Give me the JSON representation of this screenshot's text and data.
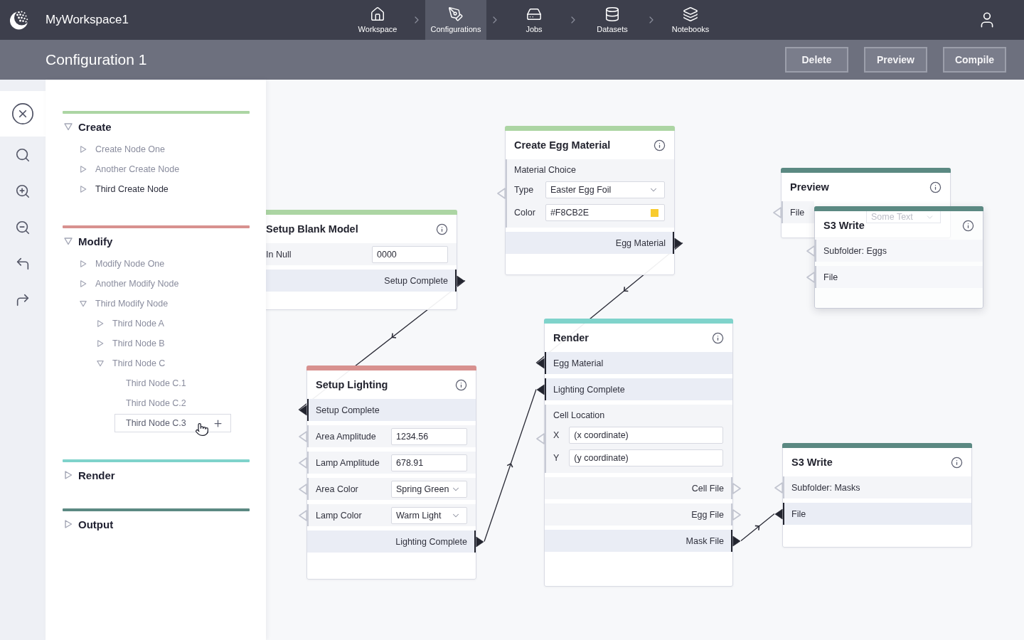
{
  "top_bar": {
    "workspace": "MyWorkspace1"
  },
  "nav": [
    {
      "kind": "home",
      "label": "Workspace",
      "selected": false
    },
    {
      "kind": "pen",
      "label": "Configurations",
      "selected": true
    },
    {
      "kind": "drive",
      "label": "Jobs",
      "selected": false
    },
    {
      "kind": "database",
      "label": "Datasets",
      "selected": false
    },
    {
      "kind": "layers",
      "label": "Notebooks",
      "selected": false
    }
  ],
  "header": {
    "title": "Configuration 1",
    "buttons": [
      "Delete",
      "Preview",
      "Compile"
    ]
  },
  "tools": [
    {
      "kind": "close",
      "selected": true
    },
    {
      "kind": "search",
      "selected": false
    },
    {
      "kind": "zoomin",
      "selected": false
    },
    {
      "kind": "zoomout",
      "selected": false
    },
    {
      "kind": "undo",
      "selected": false
    },
    {
      "kind": "redo",
      "selected": false
    }
  ],
  "palette": [
    {
      "title": "Create",
      "color": "#acd5a3",
      "expanded": true,
      "items": [
        {
          "kind": "branch",
          "label": "Create Node One",
          "expanded": false,
          "highlighted": false,
          "hovered": false
        },
        {
          "kind": "branch",
          "label": "Another Create Node",
          "expanded": false,
          "highlighted": false,
          "hovered": false
        },
        {
          "kind": "branch",
          "label": "Third Create Node",
          "expanded": false,
          "highlighted": true,
          "hovered": false
        }
      ]
    },
    {
      "title": "Modify",
      "color": "#d8918f",
      "expanded": true,
      "items": [
        {
          "kind": "branch",
          "label": "Modify Node One",
          "expanded": false,
          "highlighted": false,
          "hovered": false
        },
        {
          "kind": "branch",
          "label": "Another Modify Node",
          "expanded": false,
          "highlighted": false,
          "hovered": false
        },
        {
          "kind": "branch",
          "label": "Third Modify Node",
          "expanded": true,
          "highlighted": false,
          "hovered": false,
          "children": [
            {
              "kind": "branch",
              "label": "Third Node A",
              "expanded": false,
              "highlighted": false,
              "hovered": false
            },
            {
              "kind": "branch",
              "label": "Third Node B",
              "expanded": false,
              "highlighted": false,
              "hovered": false
            },
            {
              "kind": "branch",
              "label": "Third Node C",
              "expanded": true,
              "highlighted": false,
              "hovered": false,
              "children": [
                {
                  "kind": "leaf",
                  "label": "Third Node C.1",
                  "highlighted": false,
                  "hovered": false
                },
                {
                  "kind": "leaf",
                  "label": "Third Node C.2",
                  "highlighted": false,
                  "hovered": false
                },
                {
                  "kind": "leaf",
                  "label": "Third Node C.3",
                  "highlighted": false,
                  "hovered": true
                }
              ]
            }
          ]
        }
      ]
    },
    {
      "title": "Render",
      "color": "#7fd3cb",
      "expanded": false
    },
    {
      "title": "Output",
      "color": "#5b8982",
      "expanded": false
    }
  ],
  "nodes": [
    {
      "title": "Setup Blank Model",
      "color": "#acd5a3",
      "dragging": false,
      "rows": [
        {
          "kind": "field",
          "label": "In Null",
          "value": "0000"
        },
        {
          "kind": "out",
          "label": "Setup Complete",
          "connected": true
        }
      ]
    },
    {
      "title": "Create Egg Material",
      "color": "#acd5a3",
      "dragging": false,
      "rows": [
        {
          "kind": "group",
          "label": "Material Choice",
          "connected": false,
          "fields": [
            {
              "kind": "select",
              "label": "Type",
              "value": "Easter Egg Foil"
            },
            {
              "kind": "color",
              "label": "Color",
              "value": "#F8CB2E",
              "color": "#f8cb2e"
            }
          ]
        },
        {
          "kind": "out",
          "label": "Egg Material",
          "connected": true
        }
      ]
    },
    {
      "title": "Preview",
      "color": "#5b8982",
      "dragging": false,
      "rows": [
        {
          "kind": "in",
          "label": "File",
          "connected": false,
          "control": {
            "kind": "select",
            "placeholder": "Some Text"
          }
        }
      ]
    },
    {
      "title": "S3 Write",
      "color": "#5b8982",
      "dragging": true,
      "rows": [
        {
          "kind": "in",
          "label": "Subfolder: Eggs",
          "connected": false
        },
        {
          "kind": "in",
          "label": "File",
          "connected": false
        }
      ]
    },
    {
      "title": "Setup Lighting",
      "color": "#d8918f",
      "dragging": false,
      "rows": [
        {
          "kind": "in",
          "label": "Setup Complete",
          "connected": true
        },
        {
          "kind": "field",
          "label": "Area Amplitude",
          "value": "1234.56",
          "connected": false
        },
        {
          "kind": "field",
          "label": "Lamp Amplitude",
          "value": "678.91",
          "connected": false
        },
        {
          "kind": "select",
          "label": "Area Color",
          "value": "Spring Green",
          "connected": false
        },
        {
          "kind": "select",
          "label": "Lamp Color",
          "value": "Warm Light",
          "connected": false
        },
        {
          "kind": "out",
          "label": "Lighting Complete",
          "connected": true
        }
      ]
    },
    {
      "title": "Render",
      "color": "#7fd3cb",
      "dragging": false,
      "rows": [
        {
          "kind": "in",
          "label": "Egg Material",
          "connected": true
        },
        {
          "kind": "in",
          "label": "Lighting Complete",
          "connected": true
        },
        {
          "kind": "group",
          "label": "Cell Location",
          "connected": false,
          "fields": [
            {
              "kind": "field",
              "label": "X",
              "value": "(x coordinate)"
            },
            {
              "kind": "field",
              "label": "Y",
              "value": "(y coordinate)"
            }
          ]
        },
        {
          "kind": "out",
          "label": "Cell File",
          "connected": false
        },
        {
          "kind": "out",
          "label": "Egg File",
          "connected": false
        },
        {
          "kind": "out",
          "label": "Mask File",
          "connected": true
        }
      ]
    },
    {
      "title": "S3 Write",
      "color": "#5b8982",
      "dragging": false,
      "rows": [
        {
          "kind": "in",
          "label": "Subfolder: Masks",
          "connected": false
        },
        {
          "kind": "in",
          "label": "File",
          "connected": true
        }
      ]
    }
  ]
}
